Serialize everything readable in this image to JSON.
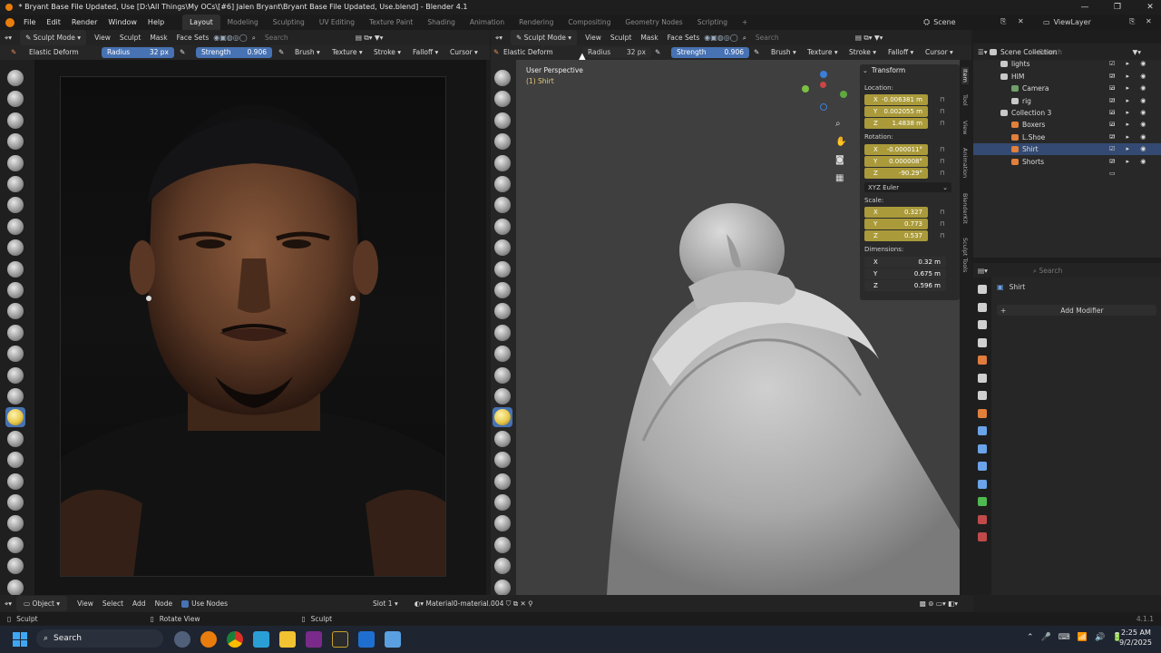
{
  "window": {
    "title": "* Bryant Base File Updated, Use [D:\\All Things\\My OCs\\[#6] Jalen Bryant\\Bryant Base File Updated, Use.blend] - Blender 4.1"
  },
  "menus": [
    "File",
    "Edit",
    "Render",
    "Window",
    "Help"
  ],
  "workspaces": [
    "Layout",
    "Modeling",
    "Sculpting",
    "UV Editing",
    "Texture Paint",
    "Shading",
    "Animation",
    "Rendering",
    "Compositing",
    "Geometry Nodes",
    "Scripting"
  ],
  "active_workspace": "Layout",
  "scene": {
    "name": "Scene",
    "view_layer": "ViewLayer"
  },
  "left_header": {
    "mode": "Sculpt Mode",
    "menus": [
      "View",
      "Sculpt",
      "Mask",
      "Face Sets"
    ],
    "search_placeholder": "Search",
    "tool_name": "Elastic Deform",
    "radius_label": "Radius",
    "radius_value": "32 px",
    "strength_label": "Strength",
    "strength_value": "0.906",
    "brush": "Brush",
    "texture": "Texture",
    "stroke": "Stroke",
    "falloff": "Falloff",
    "cursor": "Cursor"
  },
  "right_header": {
    "mode": "Sculpt Mode",
    "menus": [
      "View",
      "Sculpt",
      "Mask",
      "Face Sets"
    ],
    "search_placeholder": "Search",
    "tool_name": "Elastic Deform",
    "radius_label": "Radius",
    "radius_value": "32 px",
    "strength_label": "Strength",
    "strength_value": "0.906",
    "brush": "Brush",
    "texture": "Texture",
    "stroke": "Stroke",
    "falloff": "Falloff",
    "cursor": "Cursor"
  },
  "viewport": {
    "perspective": "User Perspective",
    "object": "(1) Shirt"
  },
  "transform": {
    "title": "Transform",
    "location_label": "Location:",
    "location": [
      {
        "axis": "X",
        "value": "-0.006381 m"
      },
      {
        "axis": "Y",
        "value": "0.002055 m"
      },
      {
        "axis": "Z",
        "value": "1.4838 m"
      }
    ],
    "rotation_label": "Rotation:",
    "rotation": [
      {
        "axis": "X",
        "value": "-0.000011°"
      },
      {
        "axis": "Y",
        "value": "0.000008°"
      },
      {
        "axis": "Z",
        "value": "-90.29°"
      }
    ],
    "rotation_mode": "XYZ Euler",
    "scale_label": "Scale:",
    "scale": [
      {
        "axis": "X",
        "value": "0.327"
      },
      {
        "axis": "Y",
        "value": "0.773"
      },
      {
        "axis": "Z",
        "value": "0.537"
      }
    ],
    "dimensions_label": "Dimensions:",
    "dimensions": [
      {
        "axis": "X",
        "value": "0.32 m"
      },
      {
        "axis": "Y",
        "value": "0.675 m"
      },
      {
        "axis": "Z",
        "value": "0.596 m"
      }
    ]
  },
  "npanel_tabs": [
    "Item",
    "Tool",
    "View",
    "Animation",
    "BlenderKit",
    "Sculpt Tools"
  ],
  "outliner": {
    "search_placeholder": "Search",
    "items": [
      {
        "label": "Scene Collection",
        "indent": 0
      },
      {
        "label": "lights",
        "indent": 1
      },
      {
        "label": "HIM",
        "indent": 1
      },
      {
        "label": "Camera",
        "indent": 2
      },
      {
        "label": "rig",
        "indent": 2
      },
      {
        "label": "Collection 3",
        "indent": 1
      },
      {
        "label": "Boxers",
        "indent": 2
      },
      {
        "label": "L.Shoe",
        "indent": 2
      },
      {
        "label": "Shirt",
        "indent": 2,
        "selected": true
      },
      {
        "label": "Shorts",
        "indent": 2
      }
    ]
  },
  "properties": {
    "search_placeholder": "Search",
    "object_name": "Shirt",
    "add_modifier": "Add Modifier"
  },
  "node_header": {
    "editor": "Object",
    "menus": [
      "View",
      "Select",
      "Add",
      "Node"
    ],
    "use_nodes": "Use Nodes",
    "slot": "Slot 1",
    "material": "Material0-material.004"
  },
  "status": {
    "left": "Sculpt",
    "middle": "Rotate View",
    "right": "Sculpt",
    "version": "4.1.1"
  },
  "taskbar": {
    "search": "Search",
    "time": "2:25 AM",
    "date": "9/2/2025"
  },
  "colors": {
    "accent": "#4772b3",
    "keyframe_field": "#aa9a3a",
    "selected_row": "#344a72"
  }
}
